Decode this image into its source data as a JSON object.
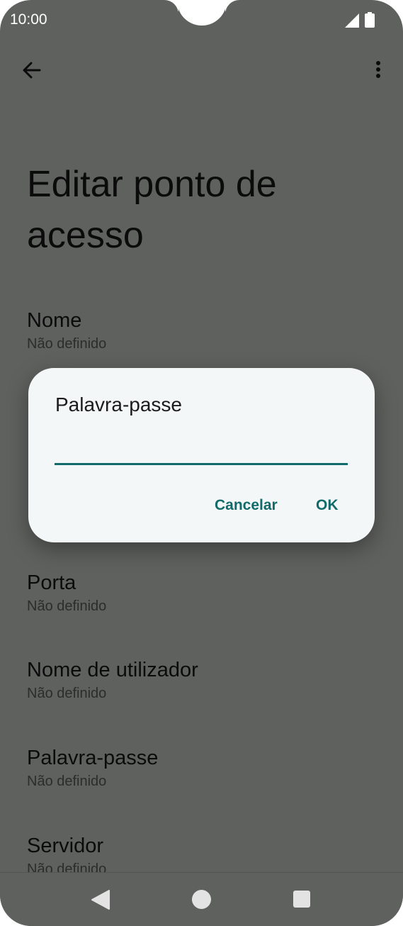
{
  "status_bar": {
    "time": "10:00"
  },
  "page": {
    "title": "Editar ponto de acesso"
  },
  "preferences": [
    {
      "title": "Nome",
      "summary": "Não definido"
    },
    {
      "title": "Porta",
      "summary": "Não definido"
    },
    {
      "title": "Nome de utilizador",
      "summary": "Não definido"
    },
    {
      "title": "Palavra-passe",
      "summary": "Não definido"
    },
    {
      "title": "Servidor",
      "summary": "Não definido"
    }
  ],
  "dialog": {
    "title": "Palavra-passe",
    "input_value": "",
    "cancel_label": "Cancelar",
    "ok_label": "OK"
  },
  "icons": {
    "back": "arrow-back-icon",
    "more": "more-vert-icon",
    "signal": "cellular-signal-icon",
    "battery": "battery-icon",
    "nav_back": "nav-back-icon",
    "nav_home": "nav-home-icon",
    "nav_recents": "nav-recents-icon"
  },
  "colors": {
    "scrim_background": "#5f615f",
    "dialog_background": "#f4f7f8",
    "accent": "#126b6b"
  }
}
